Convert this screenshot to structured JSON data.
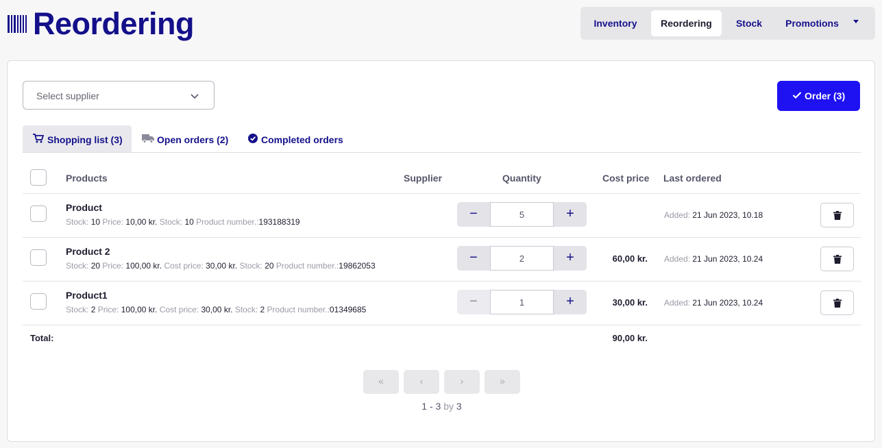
{
  "header": {
    "title": "Reordering",
    "logo_icon": "barcode-icon",
    "nav": [
      {
        "label": "Inventory",
        "active": false
      },
      {
        "label": "Reordering",
        "active": true
      },
      {
        "label": "Stock",
        "active": false
      },
      {
        "label": "Promotions",
        "active": false
      }
    ],
    "nav_more_icon": "caret-down-icon"
  },
  "toolbar": {
    "supplier_placeholder": "Select supplier",
    "order_button": "Order (3)",
    "order_color": "#1e12f2"
  },
  "tabs": [
    {
      "label": "Shopping list (3)",
      "icon": "cart-icon",
      "active": true
    },
    {
      "label": "Open orders (2)",
      "icon": "truck-icon",
      "active": false
    },
    {
      "label": "Completed orders",
      "icon": "check-circle-icon",
      "active": false
    }
  ],
  "table": {
    "columns": {
      "products": "Products",
      "supplier": "Supplier",
      "quantity": "Quantity",
      "cost_price": "Cost price",
      "last_ordered": "Last ordered"
    },
    "rows": [
      {
        "name": "Product",
        "meta": [
          {
            "k": "Stock: ",
            "v": "10 "
          },
          {
            "k": "Price: ",
            "v": "10,00 kr. "
          },
          {
            "k": "Stock: ",
            "v": "10 "
          },
          {
            "k": "Product number.:",
            "v": "193188319"
          }
        ],
        "quantity": "5",
        "cost": "",
        "added_label": "Added: ",
        "added_value": "21 Jun 2023, 10.18",
        "minus_disabled": false
      },
      {
        "name": "Product 2",
        "meta": [
          {
            "k": "Stock: ",
            "v": "20 "
          },
          {
            "k": "Price: ",
            "v": "100,00 kr. "
          },
          {
            "k": "Cost price: ",
            "v": "30,00 kr. "
          },
          {
            "k": "Stock: ",
            "v": "20 "
          },
          {
            "k": "Product number.:",
            "v": "19862053"
          }
        ],
        "quantity": "2",
        "cost": "60,00 kr.",
        "added_label": "Added: ",
        "added_value": "21 Jun 2023, 10.24",
        "minus_disabled": false
      },
      {
        "name": "Product1",
        "meta": [
          {
            "k": "Stock: ",
            "v": "2 "
          },
          {
            "k": "Price: ",
            "v": "100,00 kr. "
          },
          {
            "k": "Cost price: ",
            "v": "30,00 kr. "
          },
          {
            "k": "Stock: ",
            "v": "2 "
          },
          {
            "k": "Product number.:",
            "v": "01349685"
          }
        ],
        "quantity": "1",
        "cost": "30,00 kr.",
        "added_label": "Added: ",
        "added_value": "21 Jun 2023, 10.24",
        "minus_disabled": true
      }
    ],
    "total_label": "Total:",
    "total_value": "90,00 kr."
  },
  "pagination": {
    "first": "«",
    "prev": "‹",
    "next": "›",
    "last": "»",
    "range": "1 - 3",
    "by": "by",
    "total": "3"
  }
}
